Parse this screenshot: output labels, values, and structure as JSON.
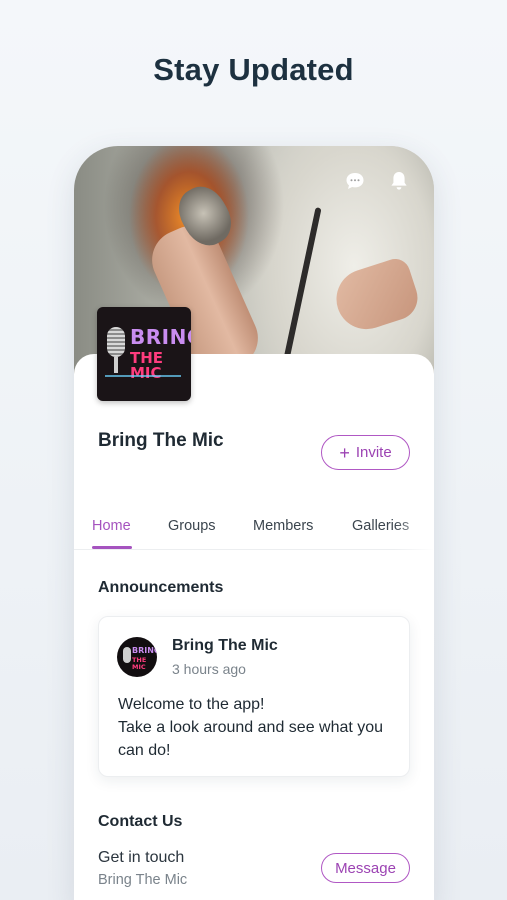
{
  "promo": {
    "title": "Stay Updated"
  },
  "header": {
    "chat_icon": "chat-bubble-icon",
    "bell_icon": "bell-icon"
  },
  "site": {
    "name": "Bring The Mic",
    "logo_line1": "BRING",
    "logo_line2": "THE MIC",
    "invite_label": "Invite"
  },
  "tabs": [
    {
      "label": "Home",
      "active": true
    },
    {
      "label": "Groups",
      "active": false
    },
    {
      "label": "Members",
      "active": false
    },
    {
      "label": "Galleries",
      "active": false
    }
  ],
  "announcements": {
    "title": "Announcements",
    "post": {
      "author": "Bring The Mic",
      "time": "3 hours ago",
      "line1": "Welcome to the app!",
      "line2": "Take a look around and see what you can do!"
    }
  },
  "contact": {
    "title": "Contact Us",
    "line": "Get in touch",
    "sub": "Bring The Mic",
    "message_label": "Message"
  },
  "colors": {
    "accent": "#a553bf",
    "title": "#1d3140"
  }
}
